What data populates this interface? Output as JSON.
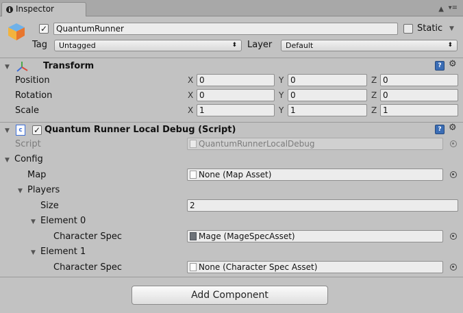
{
  "tab": {
    "title": "Inspector",
    "info_glyph": "i"
  },
  "header": {
    "object_name": "QuantumRunner",
    "active_checked": true,
    "static_label": "Static",
    "tag_label": "Tag",
    "tag_value": "Untagged",
    "layer_label": "Layer",
    "layer_value": "Default"
  },
  "transform": {
    "title": "Transform",
    "rows": [
      {
        "label": "Position",
        "x": "0",
        "y": "0",
        "z": "0"
      },
      {
        "label": "Rotation",
        "x": "0",
        "y": "0",
        "z": "0"
      },
      {
        "label": "Scale",
        "x": "1",
        "y": "1",
        "z": "1"
      }
    ],
    "axis": {
      "x": "X",
      "y": "Y",
      "z": "Z"
    }
  },
  "script_component": {
    "title": "Quantum Runner Local Debug (Script)",
    "enabled": true,
    "script_label": "Script",
    "script_value": "QuantumRunnerLocalDebug",
    "config_label": "Config",
    "map_label": "Map",
    "map_value": "None (Map Asset)",
    "players_label": "Players",
    "size_label": "Size",
    "size_value": "2",
    "element0_label": "Element 0",
    "element0_spec_label": "Character Spec",
    "element0_spec_value": "Mage (MageSpecAsset)",
    "element1_label": "Element 1",
    "element1_spec_label": "Character Spec",
    "element1_spec_value": "None (Character Spec Asset)"
  },
  "add_component": {
    "label": "Add Component"
  },
  "icons": {
    "lock": "🔒",
    "menu": "▾≡",
    "fold_open": "▼",
    "dropdown_arrow": "▼",
    "popup_arrow": "⬍",
    "help": "?",
    "gear": "⚙"
  }
}
